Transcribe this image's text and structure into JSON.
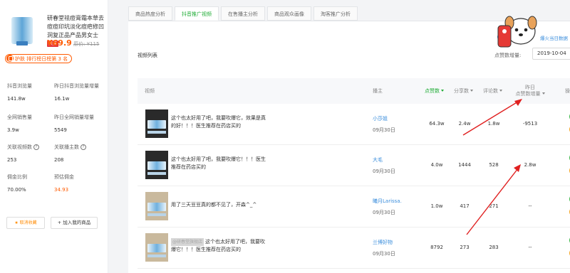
{
  "product": {
    "title": "研春堂祛痘膏霜本草去痘痘印坑淡化痘疤修凹洞复正品产品男女士",
    "tmall_badge": "天猫",
    "price": "¥69.9",
    "old_price_label": "原价: ¥115",
    "rank_text": "护肤 排行榜日榜第 3 名",
    "metrics": [
      {
        "label": "抖音浏览量",
        "value": "141.8w"
      },
      {
        "label": "昨日抖音浏览量增量",
        "value": "16.1w"
      },
      {
        "label": "全网销售量",
        "value": "3.9w"
      },
      {
        "label": "昨日全网销量增量",
        "value": "5549"
      },
      {
        "label": "关联视频数",
        "value": "253"
      },
      {
        "label": "关联播主数",
        "value": "208"
      },
      {
        "label": "佣金比例",
        "value": "70.00%"
      },
      {
        "label": "预估佣金",
        "value": "34.93"
      }
    ],
    "fav_button": "★ 取消收藏",
    "add_button": "+ 加入我的商品"
  },
  "tabs": [
    {
      "label": "商品热度分析",
      "active": false
    },
    {
      "label": "抖音推广视频",
      "active": true
    },
    {
      "label": "在售播主分析",
      "active": false
    },
    {
      "label": "商品观众画像",
      "active": false
    },
    {
      "label": "淘客推广分析",
      "active": false
    }
  ],
  "main": {
    "section_title": "视频列表",
    "hot_link": "爆火当日数据",
    "date_label": "点赞数增量:",
    "date_value": "2019-10-04"
  },
  "table": {
    "headers": {
      "video": "视频",
      "author": "播主",
      "likes": "点赞数",
      "shares": "分享数",
      "comments": "评论数",
      "yesterday_line1": "昨日",
      "yesterday_line2": "点赞数增量",
      "ops": "操"
    },
    "rows": [
      {
        "text": "这个也太好用了吧，我要吹爆它，效果是真的好！！！医生推荐在药店买的",
        "author": "小莎姐",
        "date": "09月30日",
        "likes": "64.3w",
        "shares": "2.4w",
        "comments": "1.8w",
        "delta": "-9513",
        "light": false,
        "blur_tag": ""
      },
      {
        "text": "这个也太好用了吧，我要吹爆它！！！医生推荐在药店买的",
        "author": "大毛",
        "date": "09月30日",
        "likes": "4.0w",
        "shares": "1444",
        "comments": "528",
        "delta": "2.8w",
        "light": false,
        "blur_tag": ""
      },
      {
        "text": "用了三天豆豆真的都不见了，开森^_^",
        "author": "曦月Larissa.",
        "date": "09月30日",
        "likes": "1.0w",
        "shares": "417",
        "comments": "271",
        "delta": "--",
        "light": true,
        "blur_tag": ""
      },
      {
        "text": "这个也太好用了吧，我要吹爆它！！！医生推荐在药店买的",
        "author": "兰博好物",
        "date": "09月30日",
        "likes": "8792",
        "shares": "273",
        "comments": "283",
        "delta": "--",
        "light": true,
        "blur_tag": "@研春堂旗舰店"
      }
    ]
  },
  "colors": {
    "accent_green": "#22ad38",
    "price_orange": "#ff5a00",
    "link_blue": "#3b8edc",
    "annotation_red": "#e02020"
  }
}
